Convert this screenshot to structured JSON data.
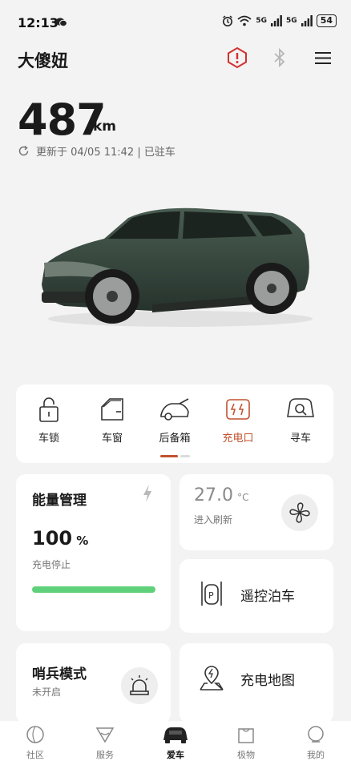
{
  "status_bar": {
    "time": "12:13",
    "network_1": "5G",
    "network_2": "5G",
    "battery": "54"
  },
  "header": {
    "title": "大傻妞"
  },
  "vehicle": {
    "range_value": "487",
    "range_unit": "km",
    "updated_text": "更新于 04/05 11:42 | 已驻车"
  },
  "quick_controls": {
    "items": [
      {
        "label": "车锁",
        "icon": "lock-icon"
      },
      {
        "label": "车窗",
        "icon": "window-icon"
      },
      {
        "label": "后备箱",
        "icon": "trunk-icon"
      },
      {
        "label": "充电口",
        "icon": "charge-port-icon"
      },
      {
        "label": "寻车",
        "icon": "find-car-icon"
      }
    ],
    "active_index": 3
  },
  "energy": {
    "title": "能量管理",
    "level_value": "100",
    "level_unit": "%",
    "level_fraction": 1.0,
    "status": "充电停止"
  },
  "temperature": {
    "value": "27.0",
    "unit": "°C",
    "hint": "进入刷新"
  },
  "remote_parking": {
    "label": "遥控泊车"
  },
  "sentry": {
    "title": "哨兵模式",
    "status": "未开启"
  },
  "charge_map": {
    "label": "充电地图"
  },
  "bottom_nav": {
    "items": [
      {
        "label": "社区",
        "icon": "community-icon"
      },
      {
        "label": "服务",
        "icon": "service-icon"
      },
      {
        "label": "爱车",
        "icon": "my-car-icon"
      },
      {
        "label": "极物",
        "icon": "shop-bag-icon"
      },
      {
        "label": "我的",
        "icon": "profile-icon"
      }
    ],
    "active_index": 2
  },
  "colors": {
    "accent": "#c2512f",
    "alert": "#d33030",
    "energy_bar": "#5fd17a",
    "car_body": "#3b4d43"
  }
}
